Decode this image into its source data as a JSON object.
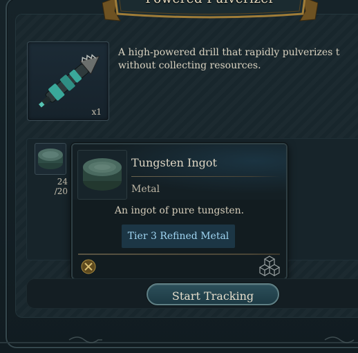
{
  "window": {
    "title": "Powered Pulverizer"
  },
  "item": {
    "quantity": "x1",
    "icon": "drill-icon",
    "description_line1": "A high-powered drill that rapidly pulverizes t",
    "description_line2": "without collecting resources."
  },
  "materials": {
    "slot_icon": "ingot-icon",
    "have": "24",
    "need": "/20"
  },
  "tooltip": {
    "name": "Tungsten Ingot",
    "type": "Metal",
    "description": "An ingot of pure tungsten.",
    "tier": "Tier 3 Refined Metal",
    "icon": "ingot-icon",
    "footer_left_icon": "pickaxe-hammer-icon",
    "footer_right_icon": "cubes-icon"
  },
  "actions": {
    "track_label": "Start Tracking"
  },
  "colors": {
    "tier_text": "#9fd5f2",
    "tier_bg": "#1c3645",
    "banner_gold": "#8a6a2c",
    "button_border": "#5f7f84"
  }
}
